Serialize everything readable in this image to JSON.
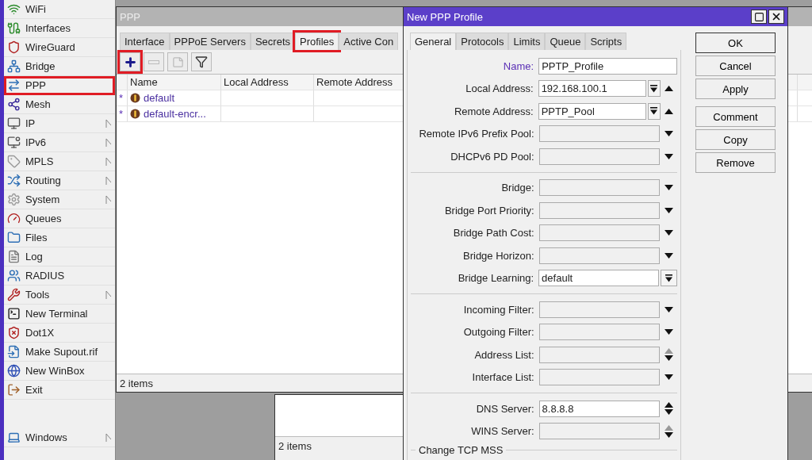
{
  "sidebar": {
    "items": [
      {
        "label": "WiFi",
        "submenu": false,
        "highlighted": false
      },
      {
        "label": "Interfaces",
        "submenu": false,
        "highlighted": false
      },
      {
        "label": "WireGuard",
        "submenu": false,
        "highlighted": false
      },
      {
        "label": "Bridge",
        "submenu": false,
        "highlighted": false
      },
      {
        "label": "PPP",
        "submenu": false,
        "highlighted": true
      },
      {
        "label": "Mesh",
        "submenu": false,
        "highlighted": false
      },
      {
        "label": "IP",
        "submenu": true,
        "highlighted": false
      },
      {
        "label": "IPv6",
        "submenu": true,
        "highlighted": false
      },
      {
        "label": "MPLS",
        "submenu": true,
        "highlighted": false
      },
      {
        "label": "Routing",
        "submenu": true,
        "highlighted": false
      },
      {
        "label": "System",
        "submenu": true,
        "highlighted": false
      },
      {
        "label": "Queues",
        "submenu": false,
        "highlighted": false
      },
      {
        "label": "Files",
        "submenu": false,
        "highlighted": false
      },
      {
        "label": "Log",
        "submenu": false,
        "highlighted": false
      },
      {
        "label": "RADIUS",
        "submenu": false,
        "highlighted": false
      },
      {
        "label": "Tools",
        "submenu": true,
        "highlighted": false
      },
      {
        "label": "New Terminal",
        "submenu": false,
        "highlighted": false
      },
      {
        "label": "Dot1X",
        "submenu": false,
        "highlighted": false
      },
      {
        "label": "Make Supout.rif",
        "submenu": false,
        "highlighted": false
      },
      {
        "label": "New WinBox",
        "submenu": false,
        "highlighted": false
      },
      {
        "label": "Exit",
        "submenu": false,
        "highlighted": false
      }
    ],
    "bottom_item": {
      "label": "Windows",
      "submenu": true
    }
  },
  "ppp_window": {
    "title": "PPP",
    "active": false,
    "tabs": [
      {
        "label": "Interface",
        "selected": false,
        "highlighted": false
      },
      {
        "label": "PPPoE Servers",
        "selected": false,
        "highlighted": false
      },
      {
        "label": "Secrets",
        "selected": false,
        "highlighted": false
      },
      {
        "label": "Profiles",
        "selected": true,
        "highlighted": true
      },
      {
        "label": "Active Con",
        "selected": false,
        "highlighted": false
      }
    ],
    "toolbar": [
      {
        "kind": "add",
        "disabled": false,
        "highlighted": true
      },
      {
        "kind": "remove",
        "disabled": true,
        "highlighted": false
      },
      {
        "kind": "comment",
        "disabled": true,
        "highlighted": false
      },
      {
        "kind": "filter",
        "disabled": false,
        "highlighted": false
      }
    ],
    "table": {
      "columns": [
        "Name",
        "Local Address",
        "Remote Address"
      ],
      "rows": [
        {
          "flag": "*",
          "name": "default"
        },
        {
          "flag": "*",
          "name": "default-encr..."
        }
      ]
    },
    "status": "2 items"
  },
  "back_window": {
    "status": "2 items"
  },
  "dialog": {
    "title": "New PPP Profile",
    "tabs": [
      {
        "label": "General",
        "selected": true
      },
      {
        "label": "Protocols",
        "selected": false
      },
      {
        "label": "Limits",
        "selected": false
      },
      {
        "label": "Queue",
        "selected": false
      },
      {
        "label": "Scripts",
        "selected": false
      }
    ],
    "groups": [
      [
        {
          "label": "Name:",
          "required": true,
          "value": "PPTP_Profile",
          "set": true,
          "dropdown_button": false,
          "up_arrow": false,
          "down_arrow": false
        },
        {
          "label": "Local Address:",
          "required": false,
          "value": "192.168.100.1",
          "set": true,
          "dropdown_button": true,
          "up_arrow": true,
          "down_arrow": false
        },
        {
          "label": "Remote Address:",
          "required": false,
          "value": "PPTP_Pool",
          "set": true,
          "dropdown_button": true,
          "up_arrow": true,
          "down_arrow": false
        },
        {
          "label": "Remote IPv6 Prefix Pool:",
          "required": false,
          "set": false,
          "dropdown_button": false,
          "up_arrow": false,
          "down_arrow": true
        },
        {
          "label": "DHCPv6 PD Pool:",
          "required": false,
          "set": false,
          "dropdown_button": false,
          "up_arrow": false,
          "down_arrow": true
        }
      ],
      [
        {
          "label": "Bridge:",
          "required": false,
          "set": false,
          "dropdown_button": false,
          "up_arrow": false,
          "down_arrow": true
        },
        {
          "label": "Bridge Port Priority:",
          "required": false,
          "set": false,
          "dropdown_button": false,
          "up_arrow": false,
          "down_arrow": true
        },
        {
          "label": "Bridge Path Cost:",
          "required": false,
          "set": false,
          "dropdown_button": false,
          "up_arrow": false,
          "down_arrow": true
        },
        {
          "label": "Bridge Horizon:",
          "required": false,
          "set": false,
          "dropdown_button": false,
          "up_arrow": false,
          "down_arrow": true
        },
        {
          "label": "Bridge Learning:",
          "required": false,
          "value": "default",
          "set": true,
          "dropdown_button": true,
          "up_arrow": false,
          "down_arrow": false
        }
      ],
      [
        {
          "label": "Incoming Filter:",
          "required": false,
          "set": false,
          "dropdown_button": false,
          "up_arrow": false,
          "down_arrow": true
        },
        {
          "label": "Outgoing Filter:",
          "required": false,
          "set": false,
          "dropdown_button": false,
          "up_arrow": false,
          "down_arrow": true
        },
        {
          "label": "Address List:",
          "required": false,
          "set": false,
          "dropdown_button": false,
          "up_arrow": true,
          "down_arrow": true
        },
        {
          "label": "Interface List:",
          "required": false,
          "set": false,
          "dropdown_button": false,
          "up_arrow": false,
          "down_arrow": true
        }
      ],
      [
        {
          "label": "DNS Server:",
          "required": false,
          "value": "8.8.8.8",
          "set": true,
          "dropdown_button": false,
          "up_arrow": true,
          "down_arrow": true
        },
        {
          "label": "WINS Server:",
          "required": false,
          "set": false,
          "dropdown_button": false,
          "up_arrow": true,
          "down_arrow": true
        }
      ]
    ],
    "section": "Change TCP MSS",
    "buttons": [
      "OK",
      "Cancel",
      "Apply",
      "Comment",
      "Copy",
      "Remove"
    ]
  }
}
